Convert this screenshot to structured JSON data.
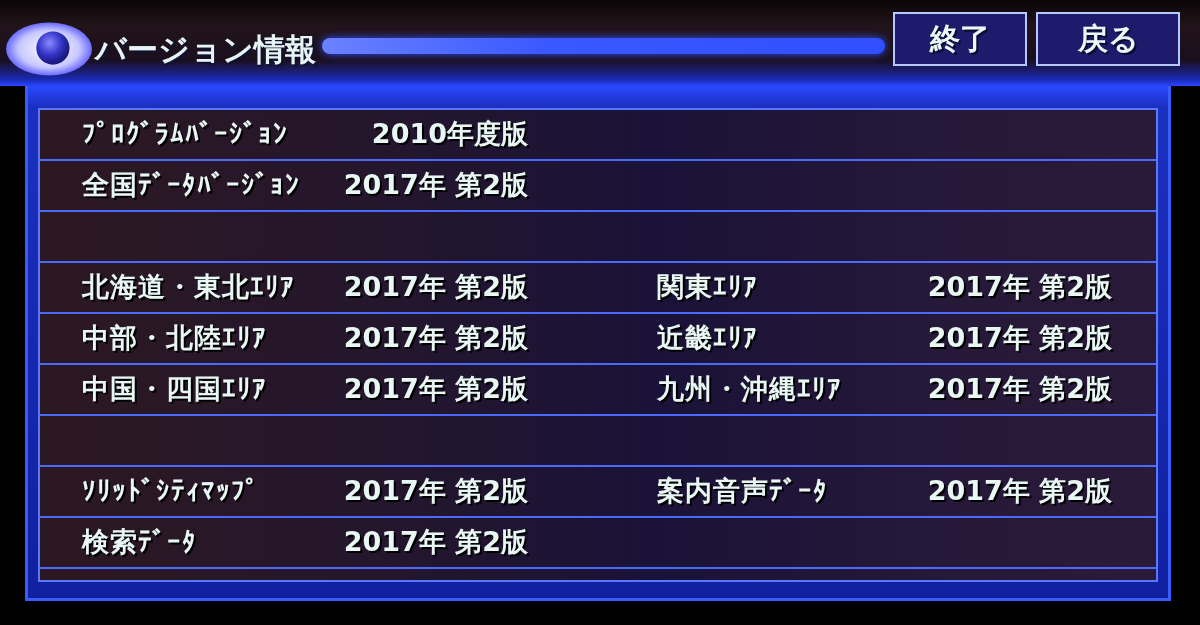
{
  "title": "バージョン情報",
  "buttons": [
    {
      "label": "終了"
    },
    {
      "label": "戻る"
    }
  ],
  "rows": [
    {
      "kind": "entries",
      "entries": [
        {
          "label": "ﾌﾟﾛｸﾞﾗﾑﾊﾞｰｼﾞｮﾝ",
          "value": "2010年度版"
        }
      ]
    },
    {
      "kind": "entries",
      "entries": [
        {
          "label": "全国ﾃﾞｰﾀﾊﾞｰｼﾞｮﾝ",
          "value": "2017年 第2版"
        }
      ]
    },
    {
      "kind": "spacer"
    },
    {
      "kind": "entries",
      "entries": [
        {
          "label": "北海道・東北ｴﾘｱ",
          "value": "2017年 第2版"
        },
        {
          "label": "関東ｴﾘｱ",
          "value": "2017年 第2版"
        }
      ]
    },
    {
      "kind": "entries",
      "entries": [
        {
          "label": "中部・北陸ｴﾘｱ",
          "value": "2017年 第2版"
        },
        {
          "label": "近畿ｴﾘｱ",
          "value": "2017年 第2版"
        }
      ]
    },
    {
      "kind": "entries",
      "entries": [
        {
          "label": "中国・四国ｴﾘｱ",
          "value": "2017年 第2版"
        },
        {
          "label": "九州・沖縄ｴﾘｱ",
          "value": "2017年 第2版"
        }
      ]
    },
    {
      "kind": "spacer"
    },
    {
      "kind": "entries",
      "entries": [
        {
          "label": "ｿﾘｯﾄﾞｼﾃｨﾏｯﾌﾟ",
          "value": "2017年 第2版"
        },
        {
          "label": "案内音声ﾃﾞｰﾀ",
          "value": "2017年 第2版"
        }
      ]
    },
    {
      "kind": "entries",
      "entries": [
        {
          "label": "検索ﾃﾞｰﾀ",
          "value": "2017年 第2版"
        }
      ]
    }
  ]
}
